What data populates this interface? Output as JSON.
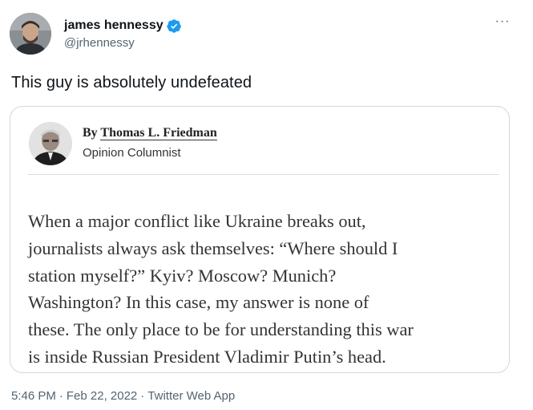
{
  "user": {
    "display_name": "james hennessy",
    "handle": "@jrhennessy",
    "verified": true
  },
  "more_icon": "···",
  "tweet": {
    "text": "This guy is absolutely undefeated"
  },
  "card": {
    "byline_prefix": "By ",
    "author_name": "Thomas L. Friedman",
    "author_role": "Opinion Columnist",
    "article_lines": [
      "When a major conflict like Ukraine breaks out,",
      "journalists always ask themselves: “Where should I",
      "station myself?” Kyiv? Moscow? Munich?",
      "Washington? In this case, my answer is none of",
      "these. The only place to be for understanding this war",
      "is inside Russian President Vladimir Putin’s head."
    ]
  },
  "meta": {
    "time": "5:46 PM",
    "date": "Feb 22, 2022",
    "source": "Twitter Web App",
    "separator": "·"
  },
  "colors": {
    "verified_blue": "#1d9bf0",
    "secondary_text": "#536471",
    "border": "#cfd9de"
  },
  "icons": {
    "avatar": "profile-avatar",
    "verified": "verified-badge-icon",
    "more": "more-options-icon",
    "author_photo": "author-headshot"
  }
}
